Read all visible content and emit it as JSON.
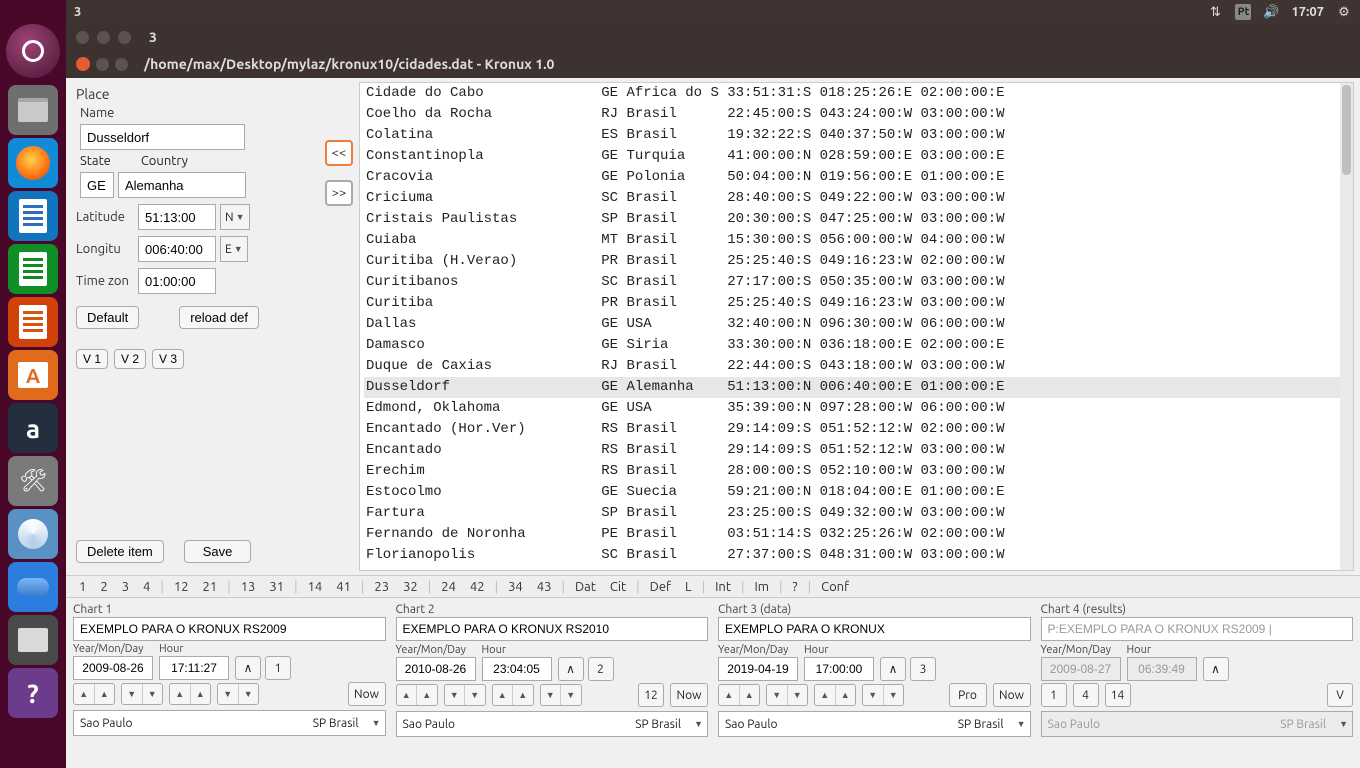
{
  "panel": {
    "left_label": "3",
    "keyboard": "Pt",
    "clock": "17:07"
  },
  "bg_window": {
    "title": "3"
  },
  "kronux": {
    "title": "/home/max/Desktop/mylaz/kronux10/cidades.dat  -  Kronux 1.0"
  },
  "place": {
    "group": "Place",
    "name_label": "Name",
    "name": "Dusseldorf",
    "state_label": "State",
    "country_label": "Country",
    "state": "GE",
    "country": "Alemanha",
    "latitude_label": "Latitude",
    "latitude": "51:13:00",
    "lat_hem": "N",
    "longitude_label": "Longitu",
    "longitude": "006:40:00",
    "lon_hem": "E",
    "tz_label": "Time zon",
    "tz": "01:00:00",
    "default_btn": "Default",
    "reload_btn": "reload def",
    "v1": "V 1",
    "v2": "V 2",
    "v3": "V 3",
    "delete_btn": "Delete item",
    "save_btn": "Save"
  },
  "transfer": {
    "left": "<<",
    "right": ">>"
  },
  "cities": [
    {
      "n": "Cidade do Cabo",
      "s": "GE",
      "c": "Africa do S",
      "lat": "33:51:31:S",
      "lon": "018:25:26:E",
      "tz": "02:00:00:E",
      "sel": false
    },
    {
      "n": "Coelho da Rocha",
      "s": "RJ",
      "c": "Brasil",
      "lat": "22:45:00:S",
      "lon": "043:24:00:W",
      "tz": "03:00:00:W",
      "sel": false
    },
    {
      "n": "Colatina",
      "s": "ES",
      "c": "Brasil",
      "lat": "19:32:22:S",
      "lon": "040:37:50:W",
      "tz": "03:00:00:W",
      "sel": false
    },
    {
      "n": "Constantinopla",
      "s": "GE",
      "c": "Turquia",
      "lat": "41:00:00:N",
      "lon": "028:59:00:E",
      "tz": "03:00:00:E",
      "sel": false
    },
    {
      "n": "Cracovia",
      "s": "GE",
      "c": "Polonia",
      "lat": "50:04:00:N",
      "lon": "019:56:00:E",
      "tz": "01:00:00:E",
      "sel": false
    },
    {
      "n": "Criciuma",
      "s": "SC",
      "c": "Brasil",
      "lat": "28:40:00:S",
      "lon": "049:22:00:W",
      "tz": "03:00:00:W",
      "sel": false
    },
    {
      "n": "Cristais Paulistas",
      "s": "SP",
      "c": "Brasil",
      "lat": "20:30:00:S",
      "lon": "047:25:00:W",
      "tz": "03:00:00:W",
      "sel": false
    },
    {
      "n": "Cuiaba",
      "s": "MT",
      "c": "Brasil",
      "lat": "15:30:00:S",
      "lon": "056:00:00:W",
      "tz": "04:00:00:W",
      "sel": false
    },
    {
      "n": "Curitiba (H.Verao)",
      "s": "PR",
      "c": "Brasil",
      "lat": "25:25:40:S",
      "lon": "049:16:23:W",
      "tz": "02:00:00:W",
      "sel": false
    },
    {
      "n": "Curitibanos",
      "s": "SC",
      "c": "Brasil",
      "lat": "27:17:00:S",
      "lon": "050:35:00:W",
      "tz": "03:00:00:W",
      "sel": false
    },
    {
      "n": "Curitiba",
      "s": "PR",
      "c": "Brasil",
      "lat": "25:25:40:S",
      "lon": "049:16:23:W",
      "tz": "03:00:00:W",
      "sel": false
    },
    {
      "n": "Dallas",
      "s": "GE",
      "c": "USA",
      "lat": "32:40:00:N",
      "lon": "096:30:00:W",
      "tz": "06:00:00:W",
      "sel": false
    },
    {
      "n": "Damasco",
      "s": "GE",
      "c": "Siria",
      "lat": "33:30:00:N",
      "lon": "036:18:00:E",
      "tz": "02:00:00:E",
      "sel": false
    },
    {
      "n": "Duque de Caxias",
      "s": "RJ",
      "c": "Brasil",
      "lat": "22:44:00:S",
      "lon": "043:18:00:W",
      "tz": "03:00:00:W",
      "sel": false
    },
    {
      "n": "Dusseldorf",
      "s": "GE",
      "c": "Alemanha",
      "lat": "51:13:00:N",
      "lon": "006:40:00:E",
      "tz": "01:00:00:E",
      "sel": true
    },
    {
      "n": "Edmond, Oklahoma",
      "s": "GE",
      "c": "USA",
      "lat": "35:39:00:N",
      "lon": "097:28:00:W",
      "tz": "06:00:00:W",
      "sel": false
    },
    {
      "n": "Encantado (Hor.Ver)",
      "s": "RS",
      "c": "Brasil",
      "lat": "29:14:09:S",
      "lon": "051:52:12:W",
      "tz": "02:00:00:W",
      "sel": false
    },
    {
      "n": "Encantado",
      "s": "RS",
      "c": "Brasil",
      "lat": "29:14:09:S",
      "lon": "051:52:12:W",
      "tz": "03:00:00:W",
      "sel": false
    },
    {
      "n": "Erechim",
      "s": "RS",
      "c": "Brasil",
      "lat": "28:00:00:S",
      "lon": "052:10:00:W",
      "tz": "03:00:00:W",
      "sel": false
    },
    {
      "n": "Estocolmo",
      "s": "GE",
      "c": "Suecia",
      "lat": "59:21:00:N",
      "lon": "018:04:00:E",
      "tz": "01:00:00:E",
      "sel": false
    },
    {
      "n": "Fartura",
      "s": "SP",
      "c": "Brasil",
      "lat": "23:25:00:S",
      "lon": "049:32:00:W",
      "tz": "03:00:00:W",
      "sel": false
    },
    {
      "n": "Fernando de Noronha",
      "s": "PE",
      "c": "Brasil",
      "lat": "03:51:14:S",
      "lon": "032:25:26:W",
      "tz": "02:00:00:W",
      "sel": false
    },
    {
      "n": "Florianopolis",
      "s": "SC",
      "c": "Brasil",
      "lat": "27:37:00:S",
      "lon": "048:31:00:W",
      "tz": "03:00:00:W",
      "sel": false
    }
  ],
  "menu": {
    "items": [
      "1",
      "2",
      "3",
      "4",
      "",
      "12",
      "21",
      "",
      "13",
      "31",
      "",
      "14",
      "41",
      "",
      "23",
      "32",
      "",
      "24",
      "42",
      "",
      "34",
      "43",
      "",
      "Dat",
      "Cit",
      "",
      "Def",
      "L",
      "",
      "Int",
      "",
      "Im",
      "",
      "?",
      "",
      "Conf"
    ]
  },
  "charts": {
    "c1": {
      "title": "Chart 1",
      "name": "EXEMPLO PARA O KRONUX RS2009",
      "date_l": "Year/Mon/Day",
      "hour_l": "Hour",
      "date": "2009-08-26",
      "hour": "17:11:27",
      "b1": "∧",
      "b2": "1",
      "now": "Now",
      "city": "Sao Paulo",
      "state": "SP Brasil"
    },
    "c2": {
      "title": "Chart 2",
      "name": "EXEMPLO PARA O KRONUX RS2010",
      "date_l": "Year/Mon/Day",
      "hour_l": "Hour",
      "date": "2010-08-26",
      "hour": "23:04:05",
      "b1": "∧",
      "b2": "2",
      "b3": "12",
      "now": "Now",
      "city": "Sao Paulo",
      "state": "SP Brasil"
    },
    "c3": {
      "title": "Chart 3 (data)",
      "name": "EXEMPLO PARA O KRONUX",
      "date_l": "Year/Mon/Day",
      "hour_l": "Hour",
      "date": "2019-04-19",
      "hour": "17:00:00",
      "b1": "∧",
      "b2": "3",
      "b3": "Pro",
      "now": "Now",
      "city": "Sao Paulo",
      "state": "SP Brasil"
    },
    "c4": {
      "title": "Chart 4 (results)",
      "name": "P:EXEMPLO PARA O KRONUX RS2009 |",
      "date_l": "Year/Mon/Day",
      "hour_l": "Hour",
      "date": "2009-08-27",
      "hour": "06:39:49",
      "b1": "∧",
      "p1": "1",
      "p4": "4",
      "p14": "14",
      "pV": "V",
      "city": "Sao Paulo",
      "state": "SP Brasil"
    }
  }
}
